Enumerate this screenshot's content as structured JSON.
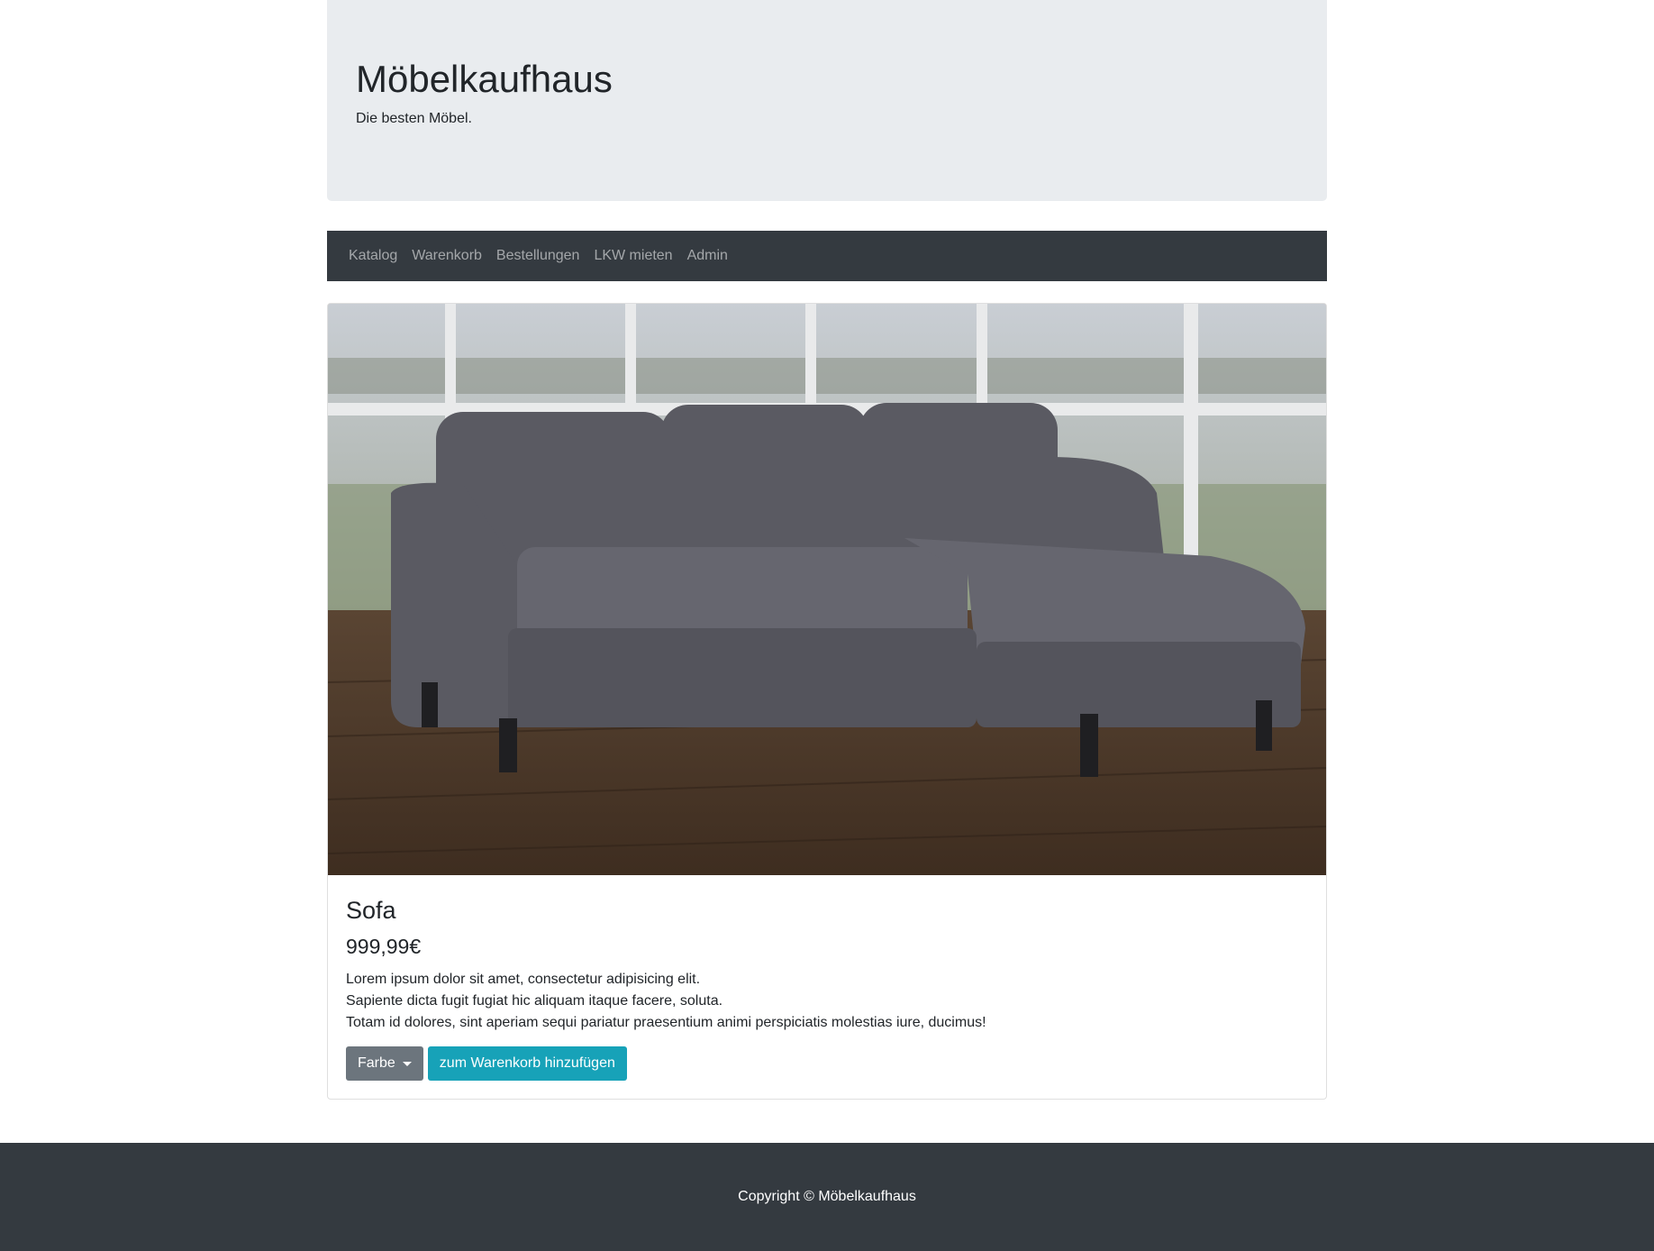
{
  "header": {
    "title": "Möbelkaufhaus",
    "tagline": "Die besten Möbel."
  },
  "nav": {
    "items": [
      {
        "label": "Katalog"
      },
      {
        "label": "Warenkorb"
      },
      {
        "label": "Bestellungen"
      },
      {
        "label": "LKW mieten"
      },
      {
        "label": "Admin"
      }
    ]
  },
  "product": {
    "image_icon": "sofa-photo",
    "name": "Sofa",
    "price": "999,99€",
    "description": [
      "Lorem ipsum dolor sit amet, consectetur adipisicing elit.",
      "Sapiente dicta fugit fugiat hic aliquam itaque facere, soluta.",
      "Totam id dolores, sint aperiam sequi pariatur praesentium animi perspiciatis molestias iure, ducimus!"
    ],
    "color_dropdown_label": "Farbe",
    "add_to_cart_label": "zum Warenkorb hinzufügen"
  },
  "footer": {
    "text": "Copyright © Möbelkaufhaus"
  },
  "colors": {
    "jumbotron_bg": "#e9ecef",
    "navbar_bg": "#343a40",
    "btn_secondary": "#6c757d",
    "btn_info": "#17a2b8",
    "footer_bg": "#343a40"
  }
}
